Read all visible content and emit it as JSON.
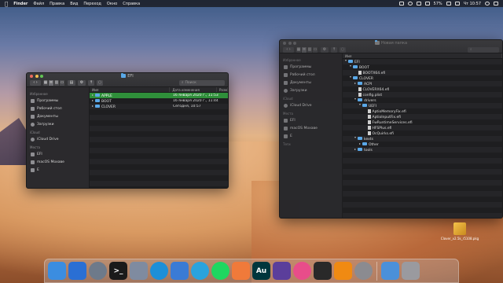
{
  "menubar": {
    "items": [
      "Finder",
      "Файл",
      "Правка",
      "Вид",
      "Переход",
      "Окно",
      "Справка"
    ],
    "battery": "57%",
    "clock": "Чт 10:57"
  },
  "left_window": {
    "title": "EFI",
    "search_placeholder": "Поиск",
    "sidebar": {
      "sections": [
        {
          "label": "Избранное",
          "items": [
            "Программы",
            "Рабочий стол",
            "Документы",
            "Загрузки"
          ]
        },
        {
          "label": "iCloud",
          "items": [
            "iCloud Drive"
          ]
        },
        {
          "label": "Места",
          "items": [
            "EFI",
            "macOS Мохаве",
            "E"
          ]
        }
      ]
    },
    "columns": [
      "Имя",
      "Дата изменения",
      "Разм"
    ],
    "rows": [
      {
        "name": "APPLE",
        "date": "16 января 2020 г., 11:53",
        "selected": true
      },
      {
        "name": "BOOT",
        "date": "16 января 2020 г., 11:44",
        "selected": false
      },
      {
        "name": "CLOVER",
        "date": "Сегодня, 10:57",
        "selected": false
      }
    ]
  },
  "right_window": {
    "title": "Новая папка",
    "sidebar": {
      "sections": [
        {
          "label": "Избранное",
          "items": [
            "Программы",
            "Рабочий стол",
            "Документы",
            "Загрузки"
          ]
        },
        {
          "label": "iCloud",
          "items": [
            "iCloud Drive"
          ]
        },
        {
          "label": "Места",
          "items": [
            "EFI",
            "macOS Мохаве",
            "E"
          ]
        },
        {
          "label": "Теги",
          "items": []
        }
      ]
    },
    "columns": [
      "Имя"
    ],
    "rows": [
      {
        "name": "EFI",
        "type": "folder",
        "level": 0,
        "open": true
      },
      {
        "name": "BOOT",
        "type": "folder",
        "level": 1,
        "open": true
      },
      {
        "name": "BOOTX64.efi",
        "type": "file",
        "level": 2
      },
      {
        "name": "CLOVER",
        "type": "folder",
        "level": 1,
        "open": true
      },
      {
        "name": "ACPI",
        "type": "folder",
        "level": 2,
        "open": false
      },
      {
        "name": "CLOVERX64.efi",
        "type": "file",
        "level": 2
      },
      {
        "name": "config.plist",
        "type": "file",
        "level": 2
      },
      {
        "name": "drivers",
        "type": "folder",
        "level": 2,
        "open": true
      },
      {
        "name": "UEFI",
        "type": "folder",
        "level": 3,
        "open": true
      },
      {
        "name": "AptioMemoryFix.efi",
        "type": "file",
        "level": 4
      },
      {
        "name": "AptioInputFix.efi",
        "type": "file",
        "level": 4
      },
      {
        "name": "FwRuntimeServices.efi",
        "type": "file",
        "level": 4
      },
      {
        "name": "HFSPlus.efi",
        "type": "file",
        "level": 4
      },
      {
        "name": "OcQuirks.efi",
        "type": "file",
        "level": 4
      },
      {
        "name": "kexts",
        "type": "folder",
        "level": 2,
        "open": true
      },
      {
        "name": "Other",
        "type": "folder",
        "level": 3,
        "open": false
      },
      {
        "name": "tools",
        "type": "folder",
        "level": 2,
        "open": false
      }
    ]
  },
  "desktop_file": {
    "label": "Clover_v2.5k_r5108.pkg"
  },
  "dock": {
    "apps": [
      {
        "name": "finder-icon",
        "color": "#3b8de0",
        "text": ""
      },
      {
        "name": "activity-icon",
        "color": "#2a6fd4",
        "text": ""
      },
      {
        "name": "launchpad-icon",
        "color": "#6e7a8a",
        "text": ""
      },
      {
        "name": "terminal-icon",
        "color": "#1a1a1a",
        "text": ">_"
      },
      {
        "name": "preview-icon",
        "color": "#7f8ba0",
        "text": ""
      },
      {
        "name": "edge-icon",
        "color": "#1d8fd8",
        "text": ""
      },
      {
        "name": "mail-icon",
        "color": "#3a7bd5",
        "text": ""
      },
      {
        "name": "telegram-icon",
        "color": "#2aa3dd",
        "text": ""
      },
      {
        "name": "spotify-icon",
        "color": "#1ed760",
        "text": ""
      },
      {
        "name": "photos-icon",
        "color": "#f07a3a",
        "text": ""
      },
      {
        "name": "audition-icon",
        "color": "#00363d",
        "text": "Au"
      },
      {
        "name": "motion-icon",
        "color": "#5b3e9b",
        "text": ""
      },
      {
        "name": "photos2-icon",
        "color": "#e84d8a",
        "text": ""
      },
      {
        "name": "finalcut-icon",
        "color": "#292929",
        "text": ""
      },
      {
        "name": "vlc-icon",
        "color": "#f08a12",
        "text": ""
      },
      {
        "name": "settings-icon",
        "color": "#8b8b90",
        "text": ""
      },
      {
        "name": "downloads-icon",
        "color": "#4a90d9",
        "text": ""
      },
      {
        "name": "trash-icon",
        "color": "#9a9a9f",
        "text": ""
      }
    ]
  }
}
